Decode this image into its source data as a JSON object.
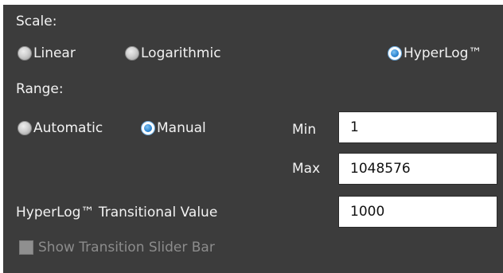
{
  "scale": {
    "heading": "Scale:",
    "options": [
      {
        "label": "Linear",
        "selected": false
      },
      {
        "label": "Logarithmic",
        "selected": false
      },
      {
        "label": "HyperLog™",
        "selected": true
      }
    ]
  },
  "range": {
    "heading": "Range:",
    "options": [
      {
        "label": "Automatic",
        "selected": false
      },
      {
        "label": "Manual",
        "selected": true
      }
    ],
    "min_label": "Min",
    "min_value": "1",
    "max_label": "Max",
    "max_value": "1048576"
  },
  "transitional": {
    "label": "HyperLog™ Transitional Value",
    "value": "1000"
  },
  "slider_checkbox": {
    "label": "Show Transition Slider Bar",
    "checked": false,
    "enabled": false
  },
  "colors": {
    "panel_background": "#3c3c3c",
    "text": "#f2f2f2",
    "radio_selected": "#2f86d1",
    "disabled_text": "#8c8c8c"
  }
}
